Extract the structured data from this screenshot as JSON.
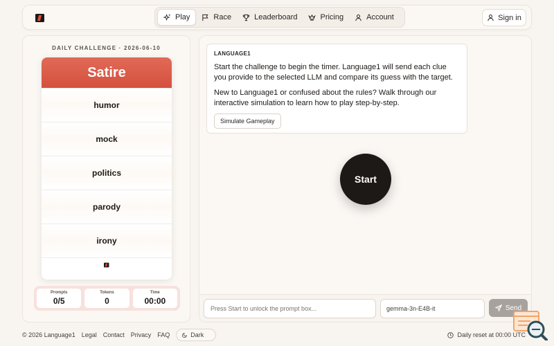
{
  "nav": {
    "items": [
      {
        "label": "Play",
        "icon": "sparkles-icon",
        "active": true
      },
      {
        "label": "Race",
        "icon": "flag-icon"
      },
      {
        "label": "Leaderboard",
        "icon": "trophy-icon"
      },
      {
        "label": "Pricing",
        "icon": "crown-icon"
      },
      {
        "label": "Account",
        "icon": "user-icon"
      }
    ],
    "signin": "Sign in"
  },
  "challenge": {
    "heading": "DAILY CHALLENGE · 2026-06-10",
    "target": "Satire",
    "taboo_words": [
      "humor",
      "mock",
      "politics",
      "parody",
      "irony"
    ]
  },
  "stats": {
    "prompts_label": "Prompts",
    "prompts_value": "0/5",
    "tokens_label": "Tokens",
    "tokens_value": "0",
    "time_label": "Time",
    "time_value": "00:00"
  },
  "message": {
    "title": "LANGUAGE1",
    "p1": "Start the challenge to begin the timer. Language1 will send each clue you provide to the selected LLM and compare its guess with the target.",
    "p2": "New to Language1 or confused about the rules? Walk through our interactive simulation to learn how to play step-by-step.",
    "button": "Simulate Gameplay"
  },
  "start_label": "Start",
  "input": {
    "placeholder": "Press Start to unlock the prompt box...",
    "model": "gemma-3n-E4B-it",
    "send": "Send"
  },
  "footer": {
    "copyright": "© 2026 Language1",
    "links": [
      "Legal",
      "Contact",
      "Privacy",
      "FAQ"
    ],
    "dark": "Dark",
    "reset": "Daily reset at 00:00 UTC"
  },
  "colors": {
    "accent": "#d9543f",
    "background": "#f8f4ef",
    "start_button": "#1c1917"
  }
}
